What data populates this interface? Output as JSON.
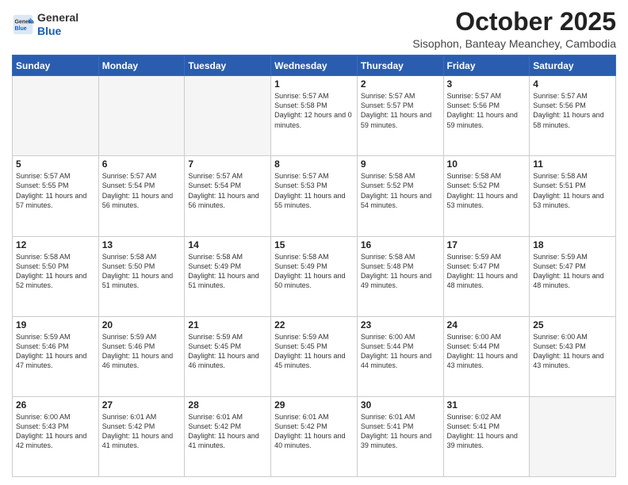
{
  "logo": {
    "general": "General",
    "blue": "Blue"
  },
  "title": "October 2025",
  "location": "Sisophon, Banteay Meanchey, Cambodia",
  "days_of_week": [
    "Sunday",
    "Monday",
    "Tuesday",
    "Wednesday",
    "Thursday",
    "Friday",
    "Saturday"
  ],
  "weeks": [
    {
      "row_class": "row-odd",
      "days": [
        {
          "date": "",
          "empty": true
        },
        {
          "date": "",
          "empty": true
        },
        {
          "date": "",
          "empty": true
        },
        {
          "date": "1",
          "sunrise": "Sunrise: 5:57 AM",
          "sunset": "Sunset: 5:58 PM",
          "daylight": "Daylight: 12 hours and 0 minutes."
        },
        {
          "date": "2",
          "sunrise": "Sunrise: 5:57 AM",
          "sunset": "Sunset: 5:57 PM",
          "daylight": "Daylight: 11 hours and 59 minutes."
        },
        {
          "date": "3",
          "sunrise": "Sunrise: 5:57 AM",
          "sunset": "Sunset: 5:56 PM",
          "daylight": "Daylight: 11 hours and 59 minutes."
        },
        {
          "date": "4",
          "sunrise": "Sunrise: 5:57 AM",
          "sunset": "Sunset: 5:56 PM",
          "daylight": "Daylight: 11 hours and 58 minutes."
        }
      ]
    },
    {
      "row_class": "row-even",
      "days": [
        {
          "date": "5",
          "sunrise": "Sunrise: 5:57 AM",
          "sunset": "Sunset: 5:55 PM",
          "daylight": "Daylight: 11 hours and 57 minutes."
        },
        {
          "date": "6",
          "sunrise": "Sunrise: 5:57 AM",
          "sunset": "Sunset: 5:54 PM",
          "daylight": "Daylight: 11 hours and 56 minutes."
        },
        {
          "date": "7",
          "sunrise": "Sunrise: 5:57 AM",
          "sunset": "Sunset: 5:54 PM",
          "daylight": "Daylight: 11 hours and 56 minutes."
        },
        {
          "date": "8",
          "sunrise": "Sunrise: 5:57 AM",
          "sunset": "Sunset: 5:53 PM",
          "daylight": "Daylight: 11 hours and 55 minutes."
        },
        {
          "date": "9",
          "sunrise": "Sunrise: 5:58 AM",
          "sunset": "Sunset: 5:52 PM",
          "daylight": "Daylight: 11 hours and 54 minutes."
        },
        {
          "date": "10",
          "sunrise": "Sunrise: 5:58 AM",
          "sunset": "Sunset: 5:52 PM",
          "daylight": "Daylight: 11 hours and 53 minutes."
        },
        {
          "date": "11",
          "sunrise": "Sunrise: 5:58 AM",
          "sunset": "Sunset: 5:51 PM",
          "daylight": "Daylight: 11 hours and 53 minutes."
        }
      ]
    },
    {
      "row_class": "row-odd",
      "days": [
        {
          "date": "12",
          "sunrise": "Sunrise: 5:58 AM",
          "sunset": "Sunset: 5:50 PM",
          "daylight": "Daylight: 11 hours and 52 minutes."
        },
        {
          "date": "13",
          "sunrise": "Sunrise: 5:58 AM",
          "sunset": "Sunset: 5:50 PM",
          "daylight": "Daylight: 11 hours and 51 minutes."
        },
        {
          "date": "14",
          "sunrise": "Sunrise: 5:58 AM",
          "sunset": "Sunset: 5:49 PM",
          "daylight": "Daylight: 11 hours and 51 minutes."
        },
        {
          "date": "15",
          "sunrise": "Sunrise: 5:58 AM",
          "sunset": "Sunset: 5:49 PM",
          "daylight": "Daylight: 11 hours and 50 minutes."
        },
        {
          "date": "16",
          "sunrise": "Sunrise: 5:58 AM",
          "sunset": "Sunset: 5:48 PM",
          "daylight": "Daylight: 11 hours and 49 minutes."
        },
        {
          "date": "17",
          "sunrise": "Sunrise: 5:59 AM",
          "sunset": "Sunset: 5:47 PM",
          "daylight": "Daylight: 11 hours and 48 minutes."
        },
        {
          "date": "18",
          "sunrise": "Sunrise: 5:59 AM",
          "sunset": "Sunset: 5:47 PM",
          "daylight": "Daylight: 11 hours and 48 minutes."
        }
      ]
    },
    {
      "row_class": "row-even",
      "days": [
        {
          "date": "19",
          "sunrise": "Sunrise: 5:59 AM",
          "sunset": "Sunset: 5:46 PM",
          "daylight": "Daylight: 11 hours and 47 minutes."
        },
        {
          "date": "20",
          "sunrise": "Sunrise: 5:59 AM",
          "sunset": "Sunset: 5:46 PM",
          "daylight": "Daylight: 11 hours and 46 minutes."
        },
        {
          "date": "21",
          "sunrise": "Sunrise: 5:59 AM",
          "sunset": "Sunset: 5:45 PM",
          "daylight": "Daylight: 11 hours and 46 minutes."
        },
        {
          "date": "22",
          "sunrise": "Sunrise: 5:59 AM",
          "sunset": "Sunset: 5:45 PM",
          "daylight": "Daylight: 11 hours and 45 minutes."
        },
        {
          "date": "23",
          "sunrise": "Sunrise: 6:00 AM",
          "sunset": "Sunset: 5:44 PM",
          "daylight": "Daylight: 11 hours and 44 minutes."
        },
        {
          "date": "24",
          "sunrise": "Sunrise: 6:00 AM",
          "sunset": "Sunset: 5:44 PM",
          "daylight": "Daylight: 11 hours and 43 minutes."
        },
        {
          "date": "25",
          "sunrise": "Sunrise: 6:00 AM",
          "sunset": "Sunset: 5:43 PM",
          "daylight": "Daylight: 11 hours and 43 minutes."
        }
      ]
    },
    {
      "row_class": "row-odd",
      "days": [
        {
          "date": "26",
          "sunrise": "Sunrise: 6:00 AM",
          "sunset": "Sunset: 5:43 PM",
          "daylight": "Daylight: 11 hours and 42 minutes."
        },
        {
          "date": "27",
          "sunrise": "Sunrise: 6:01 AM",
          "sunset": "Sunset: 5:42 PM",
          "daylight": "Daylight: 11 hours and 41 minutes."
        },
        {
          "date": "28",
          "sunrise": "Sunrise: 6:01 AM",
          "sunset": "Sunset: 5:42 PM",
          "daylight": "Daylight: 11 hours and 41 minutes."
        },
        {
          "date": "29",
          "sunrise": "Sunrise: 6:01 AM",
          "sunset": "Sunset: 5:42 PM",
          "daylight": "Daylight: 11 hours and 40 minutes."
        },
        {
          "date": "30",
          "sunrise": "Sunrise: 6:01 AM",
          "sunset": "Sunset: 5:41 PM",
          "daylight": "Daylight: 11 hours and 39 minutes."
        },
        {
          "date": "31",
          "sunrise": "Sunrise: 6:02 AM",
          "sunset": "Sunset: 5:41 PM",
          "daylight": "Daylight: 11 hours and 39 minutes."
        },
        {
          "date": "",
          "empty": true
        }
      ]
    }
  ]
}
